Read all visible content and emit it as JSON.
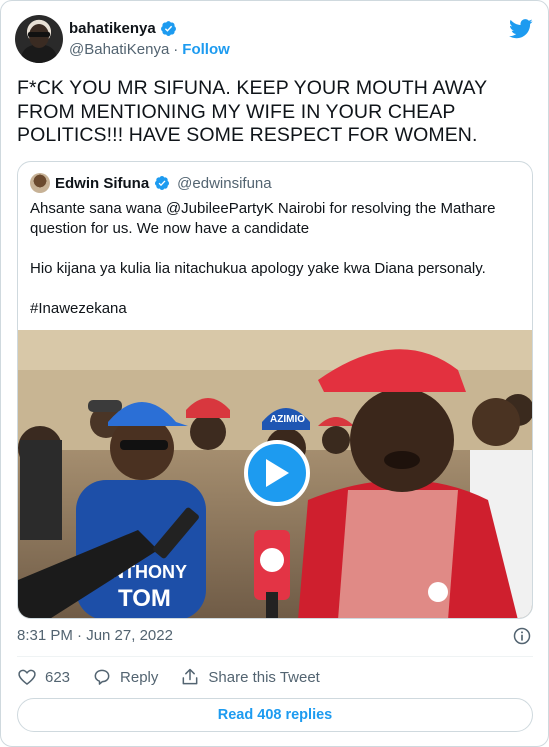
{
  "author": {
    "name": "bahatikenya",
    "handle": "@BahatiKenya",
    "follow_label": "Follow",
    "separator": "·"
  },
  "tweet": {
    "text": "F*CK YOU MR SIFUNA. KEEP YOUR MOUTH AWAY FROM MENTIONING MY WIFE IN YOUR CHEAP POLITICS!!! HAVE SOME RESPECT FOR WOMEN.",
    "timestamp": "8:31 PM · Jun 27, 2022"
  },
  "quoted": {
    "name": "Edwin Sifuna",
    "handle": "@edwinsifuna",
    "paragraphs": [
      "Ahsante sana wana @JubileePartyK Nairobi for resolving the Mathare question for us. We now have a candidate",
      "Hio kijana ya kulia lia nitachukua apology yake kwa Diana personaly.",
      "#Inawezekana"
    ],
    "media": {
      "shirt_text_line1": "ANTHONY",
      "shirt_text_line2": "TOM",
      "cap_text": "AZIMIO"
    }
  },
  "actions": {
    "likes": "623",
    "reply_label": "Reply",
    "share_label": "Share this Tweet"
  },
  "read_replies_label": "Read 408 replies",
  "colors": {
    "accent": "#1d9bf0",
    "like_red": "#f91880",
    "text": "#0f1419",
    "muted": "#536471"
  }
}
